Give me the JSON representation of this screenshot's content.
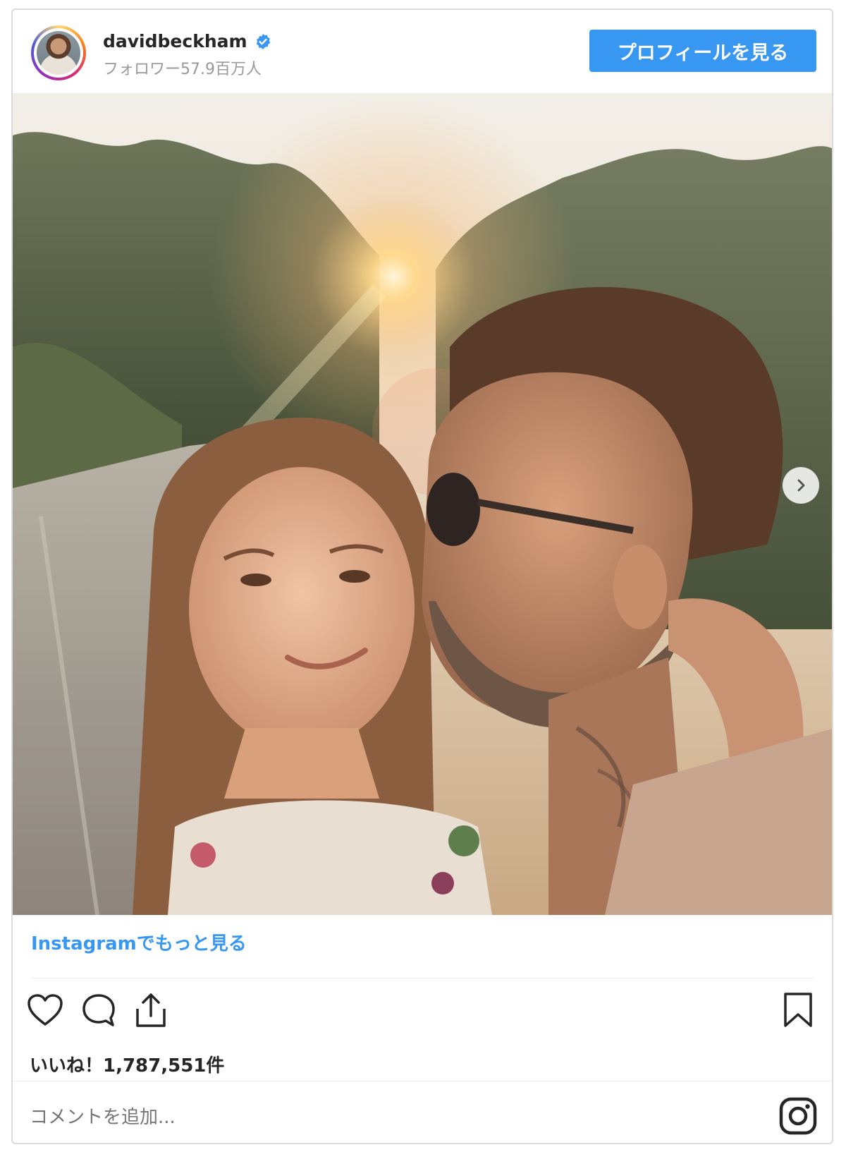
{
  "header": {
    "username": "davidbeckham",
    "followers": "フォロワー57.9百万人",
    "profile_button": "プロフィールを見る"
  },
  "post": {
    "more_link": "Instagramでもっと見る",
    "likes": "いいね！1,787,551件",
    "comment_placeholder": "コメントを追加..."
  },
  "icons": {
    "verified": "verified-badge-icon",
    "next": "chevron-right-icon",
    "like": "heart-icon",
    "comment": "comment-bubble-icon",
    "share": "share-icon",
    "save": "bookmark-icon",
    "logo": "instagram-logo-icon"
  },
  "colors": {
    "accent": "#3897f0",
    "text": "#262626",
    "muted": "#999999",
    "border": "#dbdbdb"
  }
}
